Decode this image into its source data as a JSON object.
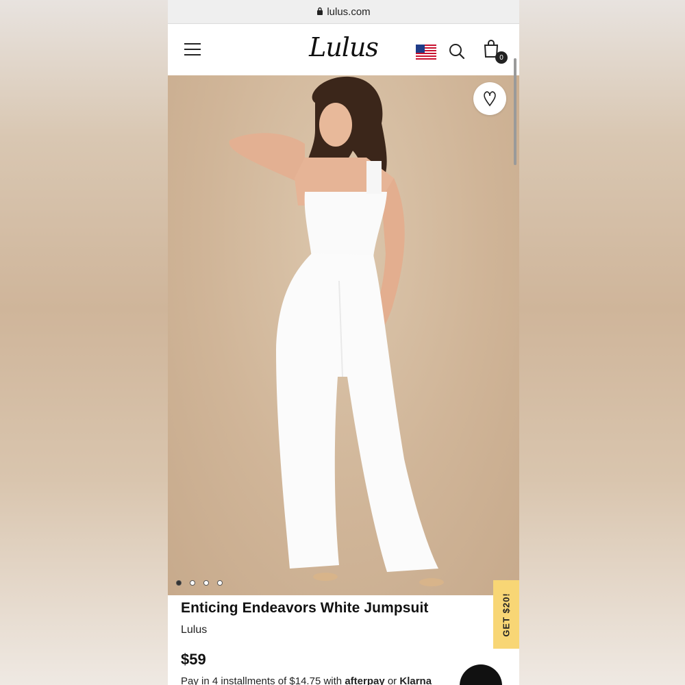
{
  "browser": {
    "url": "lulus.com"
  },
  "header": {
    "logo": "Lulus",
    "cart_count": "0",
    "icons": {
      "menu": "hamburger-menu-icon",
      "flag": "us-flag-icon",
      "search": "search-icon",
      "cart": "shopping-bag-icon"
    }
  },
  "gallery": {
    "favorite_icon": "heart-icon",
    "slides": [
      {
        "active": true
      },
      {
        "active": false
      },
      {
        "active": false
      },
      {
        "active": false
      }
    ]
  },
  "product": {
    "title": "Enticing Endeavors White Jumpsuit",
    "brand": "Lulus",
    "price": "$59",
    "installments_text": "Pay in 4 installments of $14.75 with",
    "afterpay": "afterpay",
    "or_text": "or",
    "klarna": "Klarna"
  },
  "promo": {
    "label": "GET $20!"
  },
  "colors": {
    "promo_bg": "#f8d675",
    "hero_bg": "#d0b598",
    "text": "#111111"
  }
}
